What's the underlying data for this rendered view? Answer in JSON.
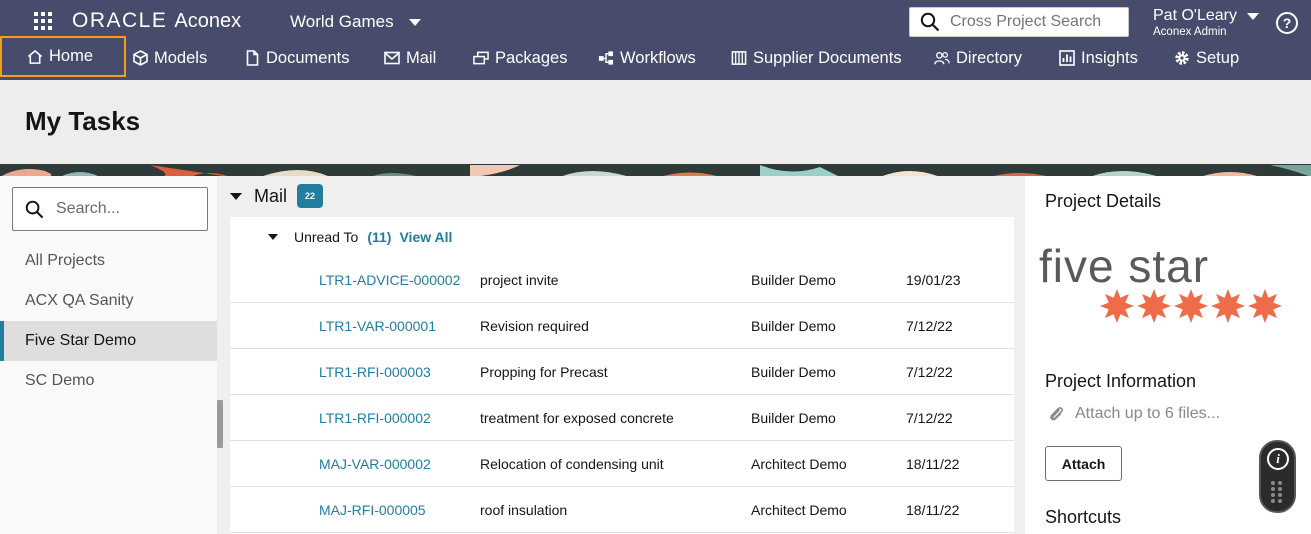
{
  "header": {
    "brand_oracle": "ORACLE",
    "brand_product": "Aconex",
    "project": "World Games",
    "search_placeholder": "Cross Project Search",
    "user_name": "Pat O'Leary",
    "user_role": "Aconex Admin",
    "help": "?"
  },
  "nav": [
    {
      "label": "Home",
      "icon": "home-icon"
    },
    {
      "label": "Models",
      "icon": "cube-icon"
    },
    {
      "label": "Documents",
      "icon": "document-icon"
    },
    {
      "label": "Mail",
      "icon": "mail-icon"
    },
    {
      "label": "Packages",
      "icon": "packages-icon"
    },
    {
      "label": "Workflows",
      "icon": "workflow-icon"
    },
    {
      "label": "Supplier Documents",
      "icon": "supplier-documents-icon"
    },
    {
      "label": "Directory",
      "icon": "people-icon"
    },
    {
      "label": "Insights",
      "icon": "chart-icon"
    },
    {
      "label": "Setup",
      "icon": "gear-icon"
    }
  ],
  "page": {
    "title": "My Tasks"
  },
  "projects": {
    "search_placeholder": "Search...",
    "items": [
      "All Projects",
      "ACX QA Sanity",
      "Five Star Demo",
      "SC Demo"
    ],
    "selected": "Five Star Demo"
  },
  "mail": {
    "label": "Mail",
    "badge": "22",
    "group_label": "Unread To",
    "group_count": "(11)",
    "view_all": "View All",
    "rows": [
      {
        "number": "LTR1-ADVICE-000002",
        "subject": "project invite",
        "from": "Builder Demo",
        "date": "19/01/23"
      },
      {
        "number": "LTR1-VAR-000001",
        "subject": "Revision required",
        "from": "Builder Demo",
        "date": "7/12/22"
      },
      {
        "number": "LTR1-RFI-000003",
        "subject": "Propping for Precast",
        "from": "Builder Demo",
        "date": "7/12/22"
      },
      {
        "number": "LTR1-RFI-000002",
        "subject": "treatment for exposed concrete",
        "from": "Builder Demo",
        "date": "7/12/22"
      },
      {
        "number": "MAJ-VAR-000002",
        "subject": "Relocation of condensing unit",
        "from": "Architect Demo",
        "date": "18/11/22"
      },
      {
        "number": "MAJ-RFI-000005",
        "subject": "roof insulation",
        "from": "Architect Demo",
        "date": "18/11/22"
      }
    ]
  },
  "details": {
    "project_details": "Project Details",
    "logo_text": "five star",
    "project_information": "Project Information",
    "attach_hint": "Attach up to 6 files...",
    "attach_button": "Attach",
    "shortcuts": "Shortcuts"
  },
  "widget": {
    "info": "i"
  },
  "colors": {
    "header_bg": "#484c6c",
    "accent": "#227e9e",
    "active_outline": "#f2a01c",
    "logo_star": "#ef6c4a",
    "logo_text": "#5a5a5a"
  }
}
